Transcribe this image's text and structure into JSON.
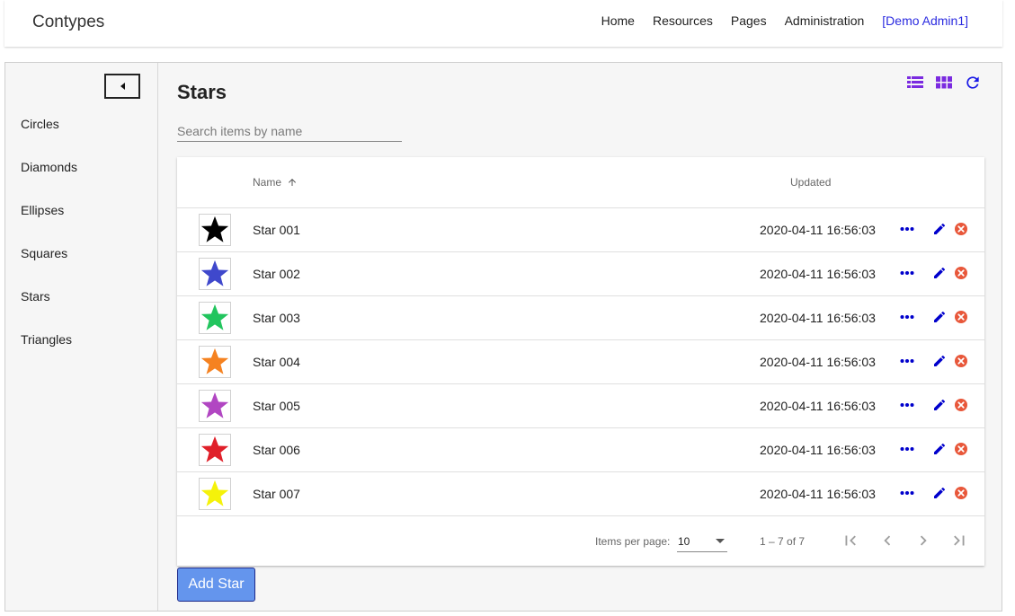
{
  "header": {
    "brand": "Contypes",
    "nav": [
      "Home",
      "Resources",
      "Pages",
      "Administration"
    ],
    "user": "[Demo Admin1]"
  },
  "sidebar": {
    "items": [
      "Circles",
      "Diamonds",
      "Ellipses",
      "Squares",
      "Stars",
      "Triangles"
    ]
  },
  "main": {
    "title": "Stars",
    "search_placeholder": "Search items by name",
    "view_icons": [
      "list-view-icon",
      "grid-view-icon",
      "refresh-icon"
    ],
    "accent_color": "#7b2be0",
    "link_color": "#0000cc",
    "delete_color": "#e8573a"
  },
  "table": {
    "columns": {
      "name": "Name",
      "updated": "Updated"
    },
    "rows": [
      {
        "name": "Star 001",
        "updated": "2020-04-11 16:56:03",
        "color": "#000000"
      },
      {
        "name": "Star 002",
        "updated": "2020-04-11 16:56:03",
        "color": "#3f48cc"
      },
      {
        "name": "Star 003",
        "updated": "2020-04-11 16:56:03",
        "color": "#22c55e"
      },
      {
        "name": "Star 004",
        "updated": "2020-04-11 16:56:03",
        "color": "#f58220"
      },
      {
        "name": "Star 005",
        "updated": "2020-04-11 16:56:03",
        "color": "#b146c2"
      },
      {
        "name": "Star 006",
        "updated": "2020-04-11 16:56:03",
        "color": "#e0202a"
      },
      {
        "name": "Star 007",
        "updated": "2020-04-11 16:56:03",
        "color": "#f5f20a"
      }
    ]
  },
  "paginator": {
    "items_per_page_label": "Items per page:",
    "items_per_page": "10",
    "range": "1 – 7 of 7"
  },
  "add_button": "Add Star"
}
